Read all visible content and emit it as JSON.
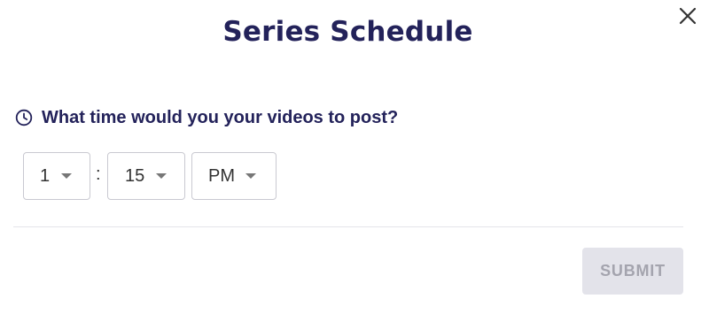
{
  "dialog": {
    "title": "Series Schedule",
    "close_icon": "close-icon"
  },
  "schedule": {
    "question_icon": "clock-icon",
    "question": "What time would you your videos to post?",
    "hour": "1",
    "separator": ":",
    "minute": "15",
    "period": "PM",
    "dropdown_icon": "chevron-down-icon"
  },
  "footer": {
    "submit_label": "SUBMIT",
    "submit_enabled": false
  },
  "colors": {
    "title": "#23225a",
    "submit_bg_disabled": "#e3e3ea",
    "submit_text_disabled": "#a4a4ae"
  }
}
